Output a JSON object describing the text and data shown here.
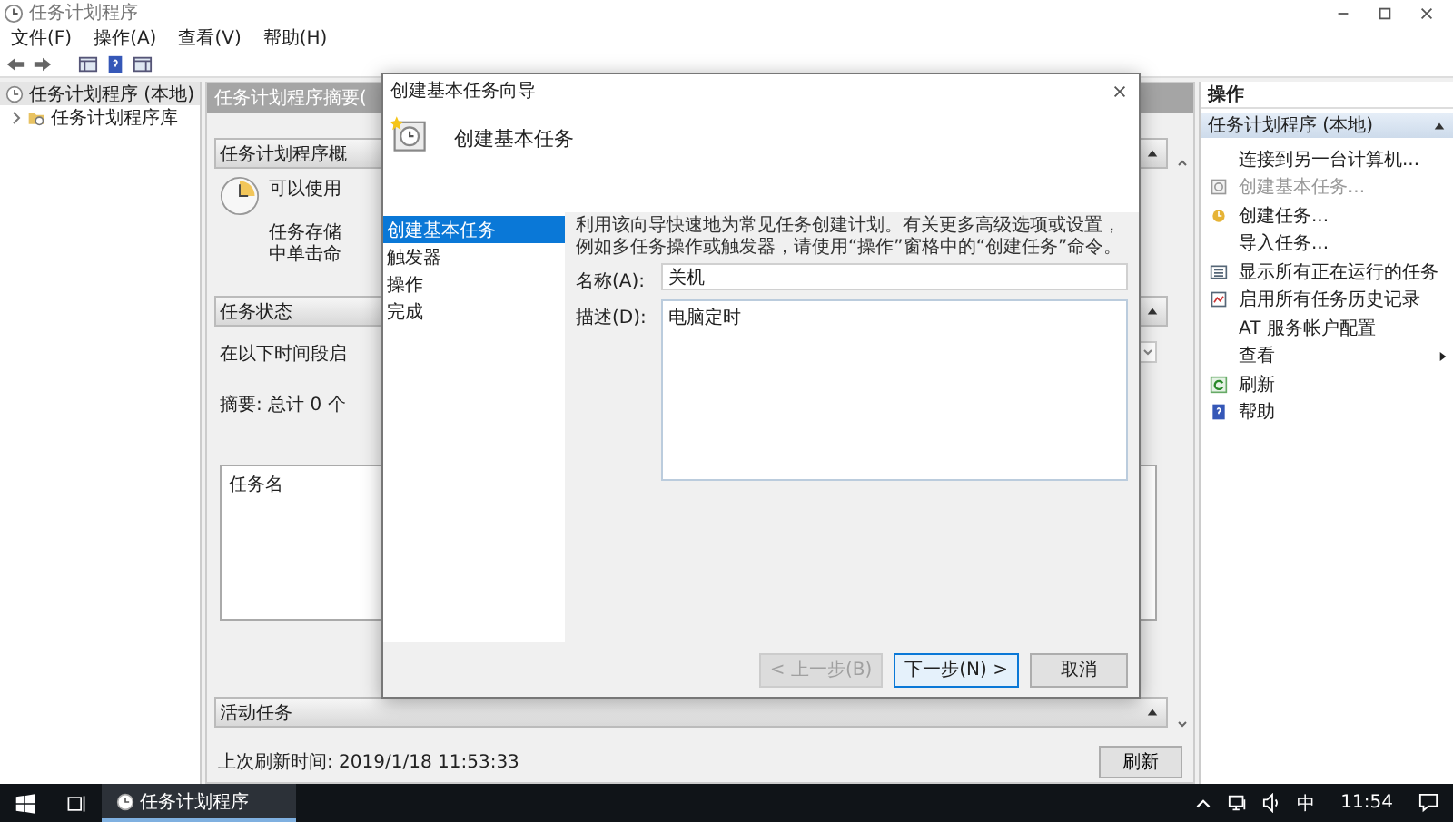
{
  "window": {
    "title": "任务计划程序"
  },
  "menu": [
    "文件(F)",
    "操作(A)",
    "查看(V)",
    "帮助(H)"
  ],
  "tree": [
    {
      "label": "任务计划程序 (本地)",
      "selected": true,
      "children": [
        {
          "label": "任务计划程序库",
          "selected": false
        }
      ]
    }
  ],
  "summary": {
    "header": "任务计划程序摘要(",
    "overview": {
      "title": "任务计划程序概",
      "lead": "可以使用",
      "lines": [
        "任务存储",
        "中单击命"
      ]
    },
    "status": {
      "title": "任务状态",
      "period_label": "在以下时间段启",
      "count": "摘要: 总计 0 个",
      "column": "任务名"
    },
    "active": {
      "title": "活动任务"
    },
    "last_refresh": "上次刷新时间: 2019/1/18 11:53:33",
    "refresh_button": "刷新"
  },
  "dialog": {
    "title": "创建基本任务向导",
    "heading": "创建基本任务",
    "steps": [
      {
        "label": "创建基本任务",
        "selected": true
      },
      {
        "label": "触发器",
        "selected": false
      },
      {
        "label": "操作",
        "selected": false
      },
      {
        "label": "完成",
        "selected": false
      }
    ],
    "intro": "利用该向导快速地为常见任务创建计划。有关更多高级选项或设置，例如多任务操作或触发器，请使用“操作”窗格中的“创建任务”命令。",
    "name_label": "名称(A):",
    "name_value": "关机",
    "desc_label": "描述(D):",
    "desc_value": "电脑定时",
    "buttons": [
      {
        "label": "< 上一步(B)",
        "disabled": true,
        "default": false
      },
      {
        "label": "下一步(N) >",
        "disabled": false,
        "default": true
      },
      {
        "label": "取消",
        "disabled": false,
        "default": false
      }
    ]
  },
  "actions": {
    "title": "操作",
    "section": "任务计划程序 (本地)",
    "items": [
      {
        "label": "连接到另一台计算机...",
        "kind": "none",
        "disabled": false,
        "submenu": false
      },
      {
        "label": "创建基本任务...",
        "kind": "wizard",
        "disabled": true,
        "submenu": false
      },
      {
        "label": "创建任务...",
        "kind": "task",
        "disabled": false,
        "submenu": false
      },
      {
        "label": "导入任务...",
        "kind": "none",
        "disabled": false,
        "submenu": false
      },
      {
        "label": "显示所有正在运行的任务",
        "kind": "list",
        "disabled": false,
        "submenu": false
      },
      {
        "label": "启用所有任务历史记录",
        "kind": "history",
        "disabled": false,
        "submenu": false
      },
      {
        "label": "AT 服务帐户配置",
        "kind": "none",
        "disabled": false,
        "submenu": false
      },
      {
        "label": "查看",
        "kind": "none",
        "disabled": false,
        "submenu": true
      },
      {
        "label": "刷新",
        "kind": "refresh",
        "disabled": false,
        "submenu": false
      },
      {
        "label": "帮助",
        "kind": "help",
        "disabled": false,
        "submenu": false
      }
    ]
  },
  "taskbar": {
    "app": "任务计划程序",
    "ime": "中",
    "time": "11:54"
  }
}
